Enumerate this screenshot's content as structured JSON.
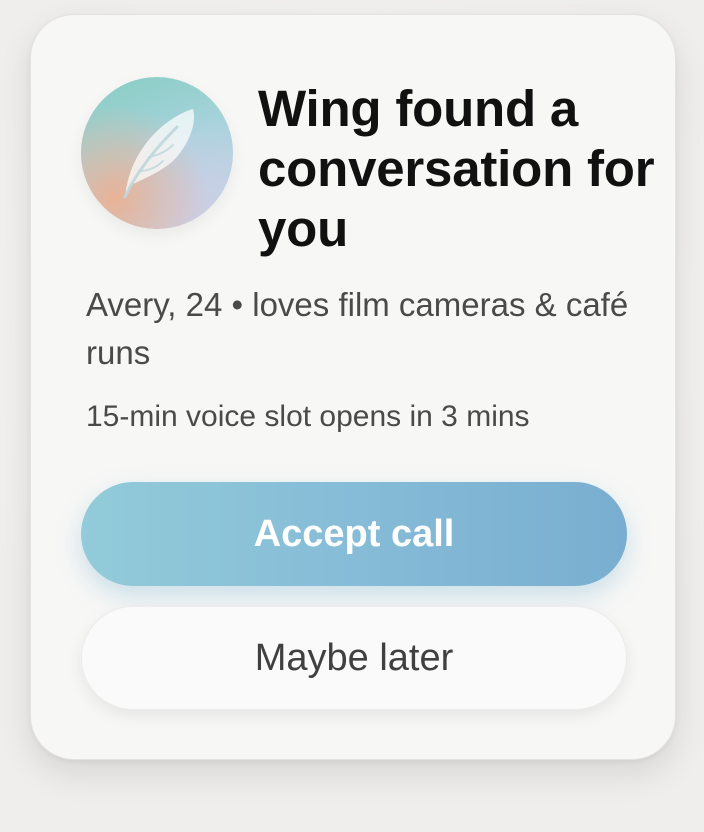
{
  "notification": {
    "title": "Wing found a conversation for you",
    "profile_line": "Avery, 24 • loves film cameras & café runs",
    "slot_line": "15-min voice slot opens in 3 mins",
    "accept_label": "Accept call",
    "later_label": "Maybe later",
    "avatar_icon": "feather-icon"
  },
  "colors": {
    "accent_start": "#92cbd9",
    "accent_end": "#79aed0",
    "title_text": "#111111",
    "body_text": "#4a4a4a"
  }
}
